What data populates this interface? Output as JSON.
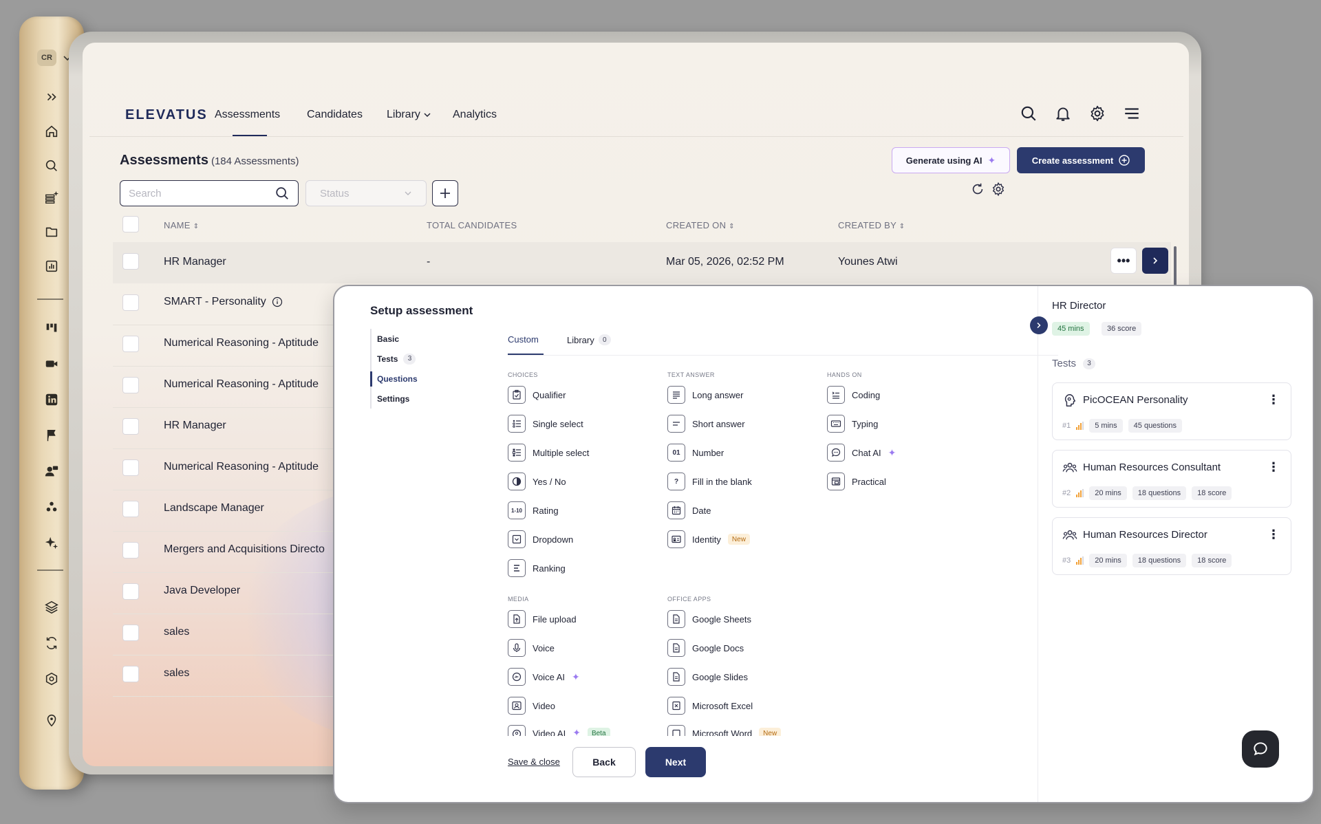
{
  "sidebar": {
    "badge": "CR"
  },
  "nav": {
    "logo": "ELEVATUS",
    "items": [
      "Assessments",
      "Candidates",
      "Library",
      "Analytics"
    ]
  },
  "page": {
    "title": "Assessments",
    "count": "(184 Assessments)",
    "generate_ai": "Generate using AI",
    "create": "Create assessment",
    "search_placeholder": "Search",
    "status_placeholder": "Status"
  },
  "table": {
    "headers": [
      "NAME",
      "TOTAL CANDIDATES",
      "CREATED ON",
      "CREATED BY"
    ],
    "rows": [
      {
        "name": "HR Manager",
        "candidates": "-",
        "created_on": "Mar 05, 2026, 02:52 PM",
        "created_by": "Younes Atwi"
      },
      {
        "name": "SMART - Personality"
      },
      {
        "name": "Numerical Reasoning - Aptitude"
      },
      {
        "name": "Numerical Reasoning - Aptitude"
      },
      {
        "name": "HR Manager"
      },
      {
        "name": "Numerical Reasoning - Aptitude"
      },
      {
        "name": "Landscape Manager"
      },
      {
        "name": "Mergers and Acquisitions Directo"
      },
      {
        "name": "Java Developer"
      },
      {
        "name": "sales"
      },
      {
        "name": "sales"
      }
    ]
  },
  "modal": {
    "title": "Setup assessment",
    "steps": [
      {
        "label": "Basic"
      },
      {
        "label": "Tests",
        "count": "3"
      },
      {
        "label": "Questions"
      },
      {
        "label": "Settings"
      }
    ],
    "tabs": [
      {
        "label": "Custom"
      },
      {
        "label": "Library",
        "count": "0"
      }
    ],
    "categories": {
      "choices": "CHOICES",
      "text_answer": "TEXT ANSWER",
      "hands_on": "HANDS ON",
      "media": "MEDIA",
      "office_apps": "OFFICE APPS"
    },
    "choices": [
      "Qualifier",
      "Single select",
      "Multiple select",
      "Yes / No",
      "Rating",
      "Dropdown",
      "Ranking"
    ],
    "text_answer": [
      "Long answer",
      "Short answer",
      "Number",
      "Fill in the blank",
      "Date",
      "Identity"
    ],
    "hands_on": [
      "Coding",
      "Typing",
      "Chat AI",
      "Practical"
    ],
    "media": [
      "File upload",
      "Voice",
      "Voice AI",
      "Video",
      "Video AI"
    ],
    "office_apps": [
      "Google Sheets",
      "Google Docs",
      "Google Slides",
      "Microsoft Excel",
      "Microsoft Word"
    ],
    "icon_text": {
      "rating": "1-10",
      "number": "01"
    },
    "tags": {
      "new": "New",
      "beta": "Beta"
    },
    "footer": {
      "save_close": "Save & close",
      "back": "Back",
      "next": "Next"
    },
    "right": {
      "title": "HR Director",
      "duration": "45 mins",
      "score": "36 score",
      "tests_label": "Tests",
      "tests_count": "3",
      "tests": [
        {
          "num": "#1",
          "name": "PicOCEAN Personality",
          "mins": "5 mins",
          "questions": "45 questions"
        },
        {
          "num": "#2",
          "name": "Human Resources Consultant",
          "mins": "20 mins",
          "questions": "18 questions",
          "score": "18 score"
        },
        {
          "num": "#3",
          "name": "Human Resources Director",
          "mins": "20 mins",
          "questions": "18 questions",
          "score": "18 score"
        }
      ]
    }
  },
  "colors": {
    "primary": "#2c3a6e",
    "accent_ai": "#9b7bf0",
    "gold": "#e9d8b6"
  }
}
